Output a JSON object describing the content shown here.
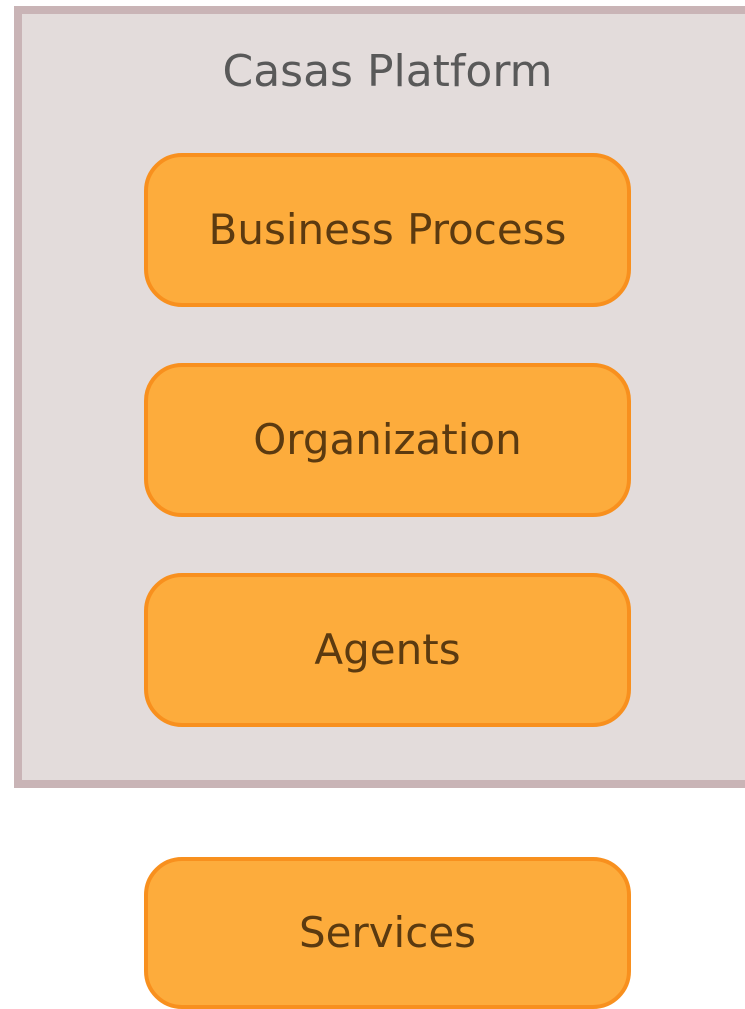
{
  "platform": {
    "title": "Casas Platform",
    "components": [
      {
        "label": "Business Process"
      },
      {
        "label": "Organization"
      },
      {
        "label": "Agents"
      }
    ]
  },
  "external": {
    "services_label": "Services"
  },
  "colors": {
    "container_fill": "#e3dcdb",
    "container_border": "#c9b4b6",
    "box_fill": "#fdac3c",
    "box_border": "#f8901e",
    "box_text": "#5b3a10",
    "title_text": "#595959"
  }
}
